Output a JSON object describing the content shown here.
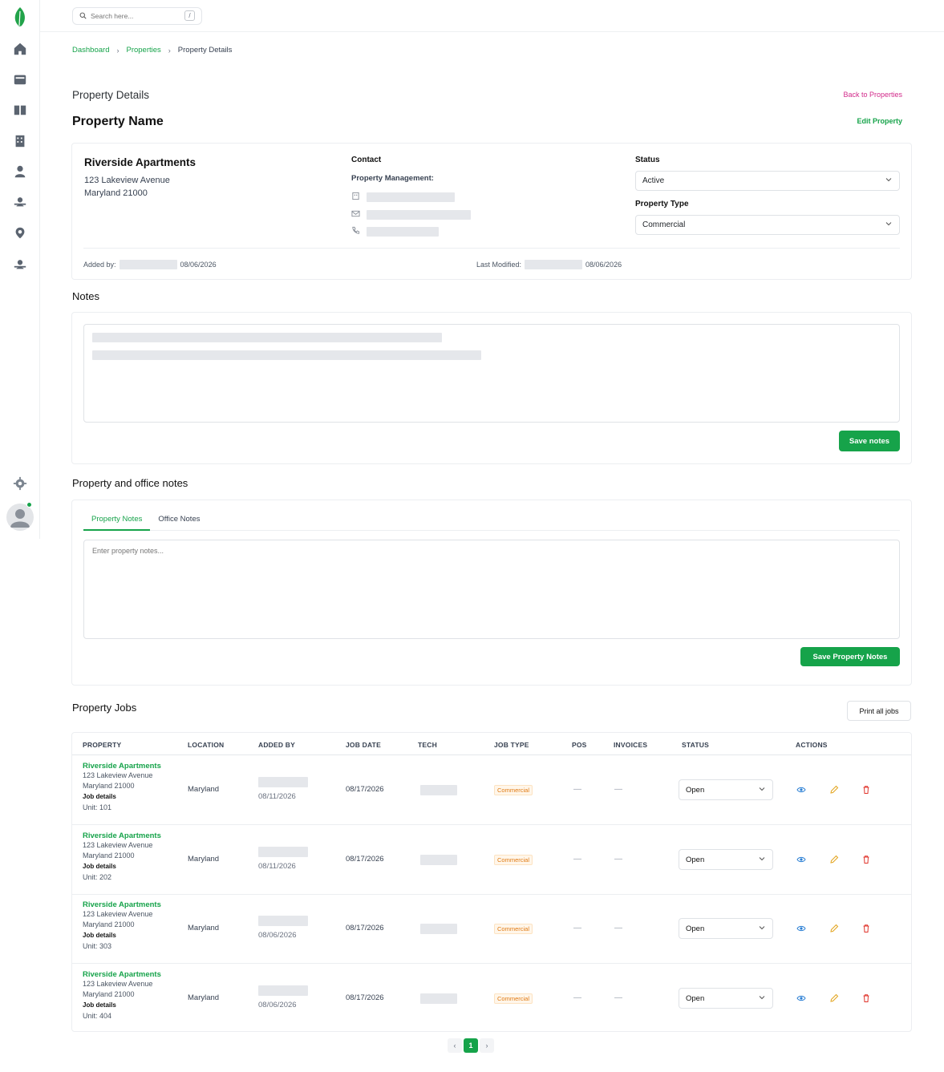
{
  "search": {
    "placeholder": "Search here...",
    "shortcut": "/"
  },
  "breadcrumb": {
    "items": [
      "Dashboard",
      "Properties"
    ],
    "current": "Property Details"
  },
  "header": {
    "subtitle": "Property Details",
    "title": "Property Name",
    "back_link": "Back to Properties",
    "edit_link": "Edit Property"
  },
  "property": {
    "name": "Riverside Apartments",
    "address_line1": "123 Lakeview Avenue",
    "address_line2": "Maryland 21000",
    "contact_title": "Contact",
    "management_label": "Property Management:",
    "status_label": "Status",
    "status_value": "Active",
    "type_label": "Property Type",
    "type_value": "Commercial",
    "added_by_label": "Added by:",
    "added_date": "08/06/2026",
    "modified_label": "Last Modified:",
    "modified_date": "08/06/2026"
  },
  "notes": {
    "title": "Notes",
    "save_label": "Save notes"
  },
  "office_notes": {
    "title": "Property and office notes",
    "tabs": [
      "Property Notes",
      "Office Notes"
    ],
    "placeholder": "Enter property notes...",
    "save_label": "Save Property Notes"
  },
  "jobs": {
    "title": "Property Jobs",
    "print_label": "Print all jobs",
    "columns": [
      "PROPERTY",
      "LOCATION",
      "ADDED BY",
      "JOB DATE",
      "TECH",
      "JOB TYPE",
      "POS",
      "INVOICES",
      "STATUS",
      "ACTIONS"
    ],
    "rows": [
      {
        "property": "Riverside Apartments",
        "addr1": "123 Lakeview Avenue",
        "addr2": "Maryland 21000",
        "details": "Job details",
        "unit": "Unit: 101",
        "location": "Maryland",
        "added_date": "08/11/2026",
        "job_date": "08/17/2026",
        "job_type": "Commercial",
        "pos": "—",
        "invoices": "—",
        "status": "Open"
      },
      {
        "property": "Riverside Apartments",
        "addr1": "123 Lakeview Avenue",
        "addr2": "Maryland 21000",
        "details": "Job details",
        "unit": "Unit: 202",
        "location": "Maryland",
        "added_date": "08/11/2026",
        "job_date": "08/17/2026",
        "job_type": "Commercial",
        "pos": "—",
        "invoices": "—",
        "status": "Open"
      },
      {
        "property": "Riverside Apartments",
        "addr1": "123 Lakeview Avenue",
        "addr2": "Maryland 21000",
        "details": "Job details",
        "unit": "Unit: 303",
        "location": "Maryland",
        "added_date": "08/06/2026",
        "job_date": "08/17/2026",
        "job_type": "Commercial",
        "pos": "—",
        "invoices": "—",
        "status": "Open"
      },
      {
        "property": "Riverside Apartments",
        "addr1": "123 Lakeview Avenue",
        "addr2": "Maryland 21000",
        "details": "Job details",
        "unit": "Unit: 404",
        "location": "Maryland",
        "added_date": "08/06/2026",
        "job_date": "08/17/2026",
        "job_type": "Commercial",
        "pos": "—",
        "invoices": "—",
        "status": "Open"
      }
    ]
  },
  "pagination": {
    "prev": "‹",
    "current": "1",
    "next": "›"
  },
  "colors": {
    "accent": "#16a34a",
    "link_pink": "#d22a8a",
    "badge_orange": "#e07b14",
    "view_blue": "#2b7fd4",
    "edit_orange": "#e2a31b",
    "delete_red": "#e0342b"
  }
}
